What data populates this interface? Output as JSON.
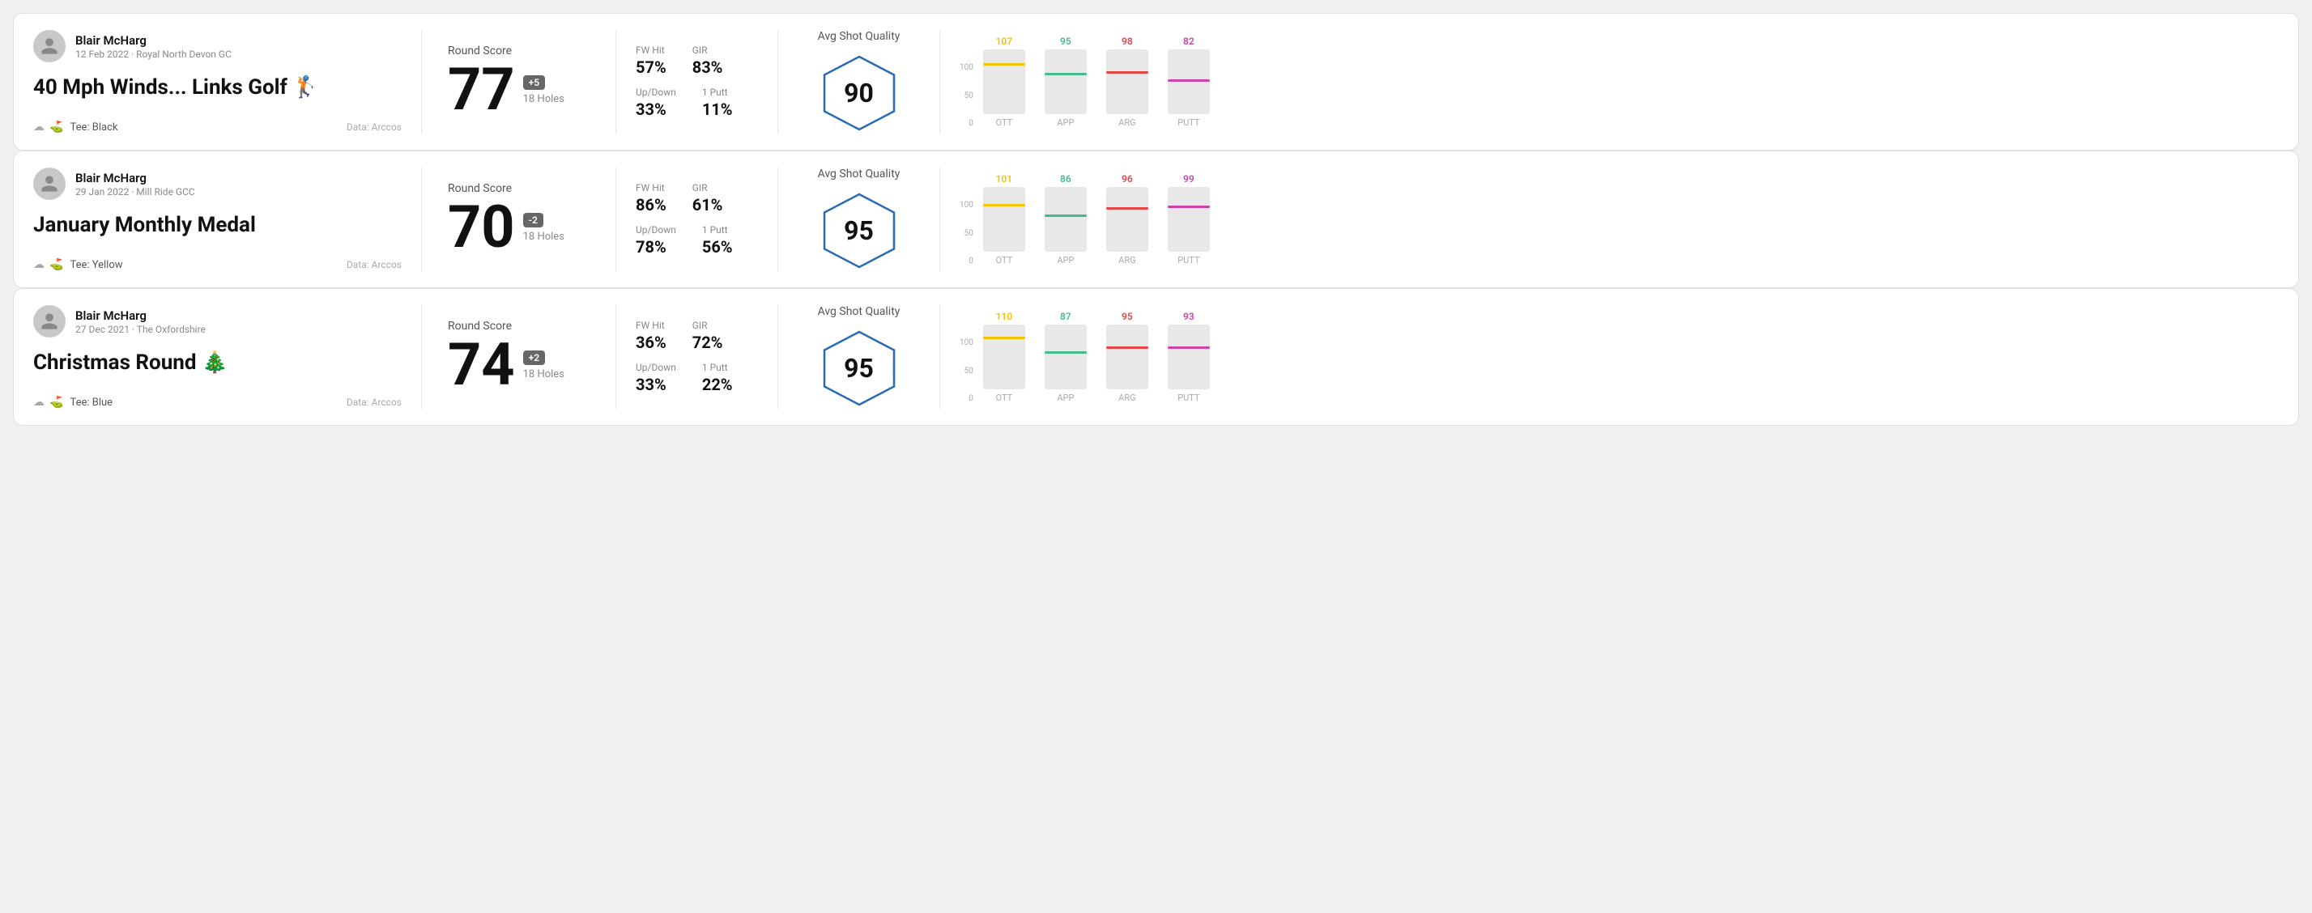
{
  "cards": [
    {
      "id": "card1",
      "user": {
        "name": "Blair McHarg",
        "date": "12 Feb 2022 · Royal North Devon GC"
      },
      "title": "40 Mph Winds... Links Golf 🏌️",
      "tee": "Black",
      "dataSource": "Data: Arccos",
      "score": {
        "label": "Round Score",
        "number": "77",
        "badge": "+5",
        "badgeType": "positive",
        "holes": "18 Holes"
      },
      "stats": [
        {
          "label": "FW Hit",
          "value": "57%"
        },
        {
          "label": "GIR",
          "value": "83%"
        },
        {
          "label": "Up/Down",
          "value": "33%"
        },
        {
          "label": "1 Putt",
          "value": "11%"
        }
      ],
      "quality": {
        "label": "Avg Shot Quality",
        "score": "90"
      },
      "chart": {
        "bars": [
          {
            "label": "OTT",
            "value": 107,
            "color": "#f5c400",
            "pct": 75
          },
          {
            "label": "APP",
            "value": 95,
            "color": "#44bb88",
            "pct": 60
          },
          {
            "label": "ARG",
            "value": 98,
            "color": "#e84444",
            "pct": 62
          },
          {
            "label": "PUTT",
            "value": 82,
            "color": "#cc44aa",
            "pct": 50
          }
        ]
      }
    },
    {
      "id": "card2",
      "user": {
        "name": "Blair McHarg",
        "date": "29 Jan 2022 · Mill Ride GCC"
      },
      "title": "January Monthly Medal",
      "tee": "Yellow",
      "dataSource": "Data: Arccos",
      "score": {
        "label": "Round Score",
        "number": "70",
        "badge": "-2",
        "badgeType": "negative",
        "holes": "18 Holes"
      },
      "stats": [
        {
          "label": "FW Hit",
          "value": "86%"
        },
        {
          "label": "GIR",
          "value": "61%"
        },
        {
          "label": "Up/Down",
          "value": "78%"
        },
        {
          "label": "1 Putt",
          "value": "56%"
        }
      ],
      "quality": {
        "label": "Avg Shot Quality",
        "score": "95"
      },
      "chart": {
        "bars": [
          {
            "label": "OTT",
            "value": 101,
            "color": "#f5c400",
            "pct": 70
          },
          {
            "label": "APP",
            "value": 86,
            "color": "#44bb88",
            "pct": 54
          },
          {
            "label": "ARG",
            "value": 96,
            "color": "#e84444",
            "pct": 65
          },
          {
            "label": "PUTT",
            "value": 99,
            "color": "#cc44aa",
            "pct": 68
          }
        ]
      }
    },
    {
      "id": "card3",
      "user": {
        "name": "Blair McHarg",
        "date": "27 Dec 2021 · The Oxfordshire"
      },
      "title": "Christmas Round 🎄",
      "tee": "Blue",
      "dataSource": "Data: Arccos",
      "score": {
        "label": "Round Score",
        "number": "74",
        "badge": "+2",
        "badgeType": "positive",
        "holes": "18 Holes"
      },
      "stats": [
        {
          "label": "FW Hit",
          "value": "36%"
        },
        {
          "label": "GIR",
          "value": "72%"
        },
        {
          "label": "Up/Down",
          "value": "33%"
        },
        {
          "label": "1 Putt",
          "value": "22%"
        }
      ],
      "quality": {
        "label": "Avg Shot Quality",
        "score": "95"
      },
      "chart": {
        "bars": [
          {
            "label": "OTT",
            "value": 110,
            "color": "#f5c400",
            "pct": 78
          },
          {
            "label": "APP",
            "value": 87,
            "color": "#44bb88",
            "pct": 55
          },
          {
            "label": "ARG",
            "value": 95,
            "color": "#e84444",
            "pct": 63
          },
          {
            "label": "PUTT",
            "value": 93,
            "color": "#cc44aa",
            "pct": 62
          }
        ]
      }
    }
  ],
  "axisLabels": [
    "100",
    "50",
    "0"
  ]
}
